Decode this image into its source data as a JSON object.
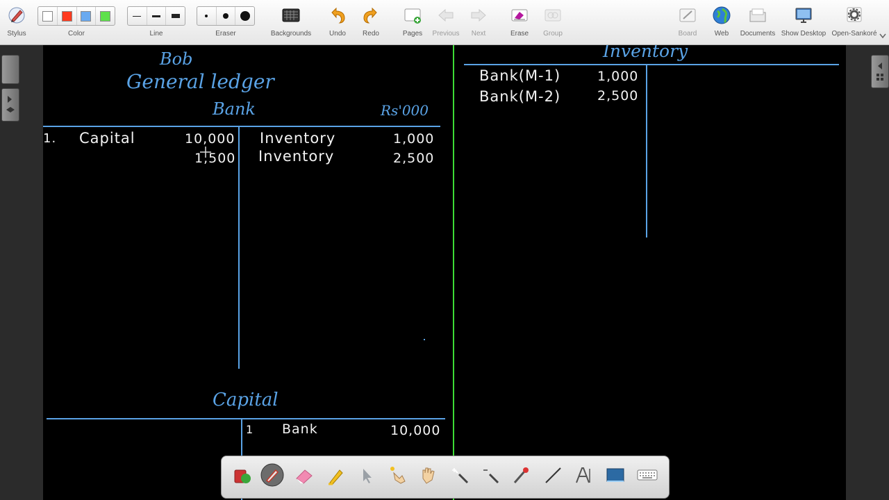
{
  "toolbar": {
    "stylus": "Stylus",
    "color": "Color",
    "line": "Line",
    "eraser": "Eraser",
    "backgrounds": "Backgrounds",
    "undo": "Undo",
    "redo": "Redo",
    "pages": "Pages",
    "previous": "Previous",
    "next": "Next",
    "erase": "Erase",
    "group": "Group",
    "board": "Board",
    "web": "Web",
    "documents": "Documents",
    "show_desktop": "Show Desktop",
    "open_sankore": "Open-Sankoré"
  },
  "colors": {
    "ink_blue": "#5aa3e6",
    "ink_white": "#f2f2f2",
    "divider_green": "#3ddc35",
    "swatches": [
      "#ffffff",
      "#ff3b1f",
      "#6aaaf0",
      "#5ee14b"
    ]
  },
  "board": {
    "heading_name": "Bob",
    "heading_title": "General ledger",
    "bank": {
      "title": "Bank",
      "unit": "Rs'000",
      "debit": [
        {
          "num": "1.",
          "label": "Capital",
          "amount": "10,000"
        },
        {
          "num": "",
          "label": "",
          "amount": "1,500"
        }
      ],
      "credit": [
        {
          "label": "Inventory",
          "amount": "1,000"
        },
        {
          "label": "Inventory",
          "amount": "2,500"
        }
      ]
    },
    "capital": {
      "title": "Capital",
      "credit": [
        {
          "num": "1",
          "label": "Bank",
          "amount": "10,000"
        }
      ]
    },
    "inventory": {
      "title": "Inventory",
      "debit": [
        {
          "label": "Bank(M-1)",
          "amount": "1,000"
        },
        {
          "label": "Bank(M-2)",
          "amount": "2,500"
        }
      ]
    }
  },
  "dock": {
    "tools": [
      "library-icon",
      "pen-icon",
      "eraser-icon",
      "highlighter-icon",
      "selector-icon",
      "interact-icon",
      "hand-icon",
      "zoom-in-icon",
      "zoom-out-icon",
      "laser-icon",
      "line-icon",
      "text-icon",
      "capture-icon",
      "keyboard-icon"
    ]
  }
}
